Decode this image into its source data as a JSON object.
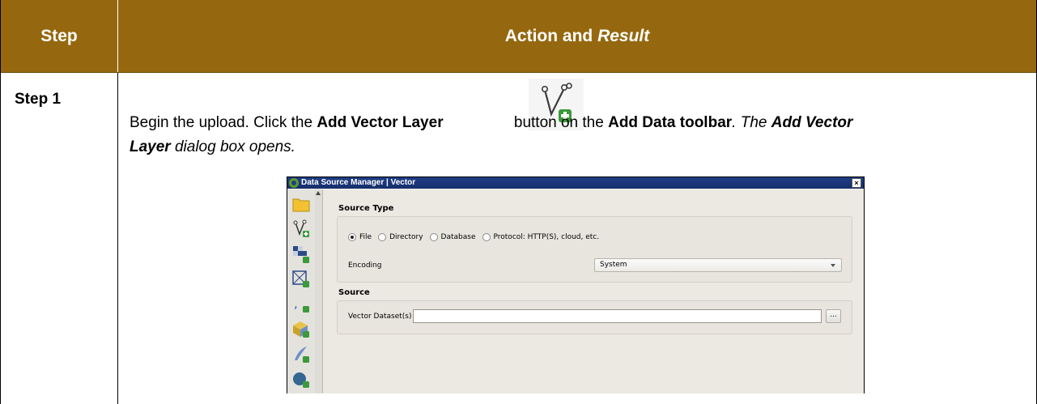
{
  "table": {
    "header_step": "Step",
    "header_action": "Action and",
    "header_result": "Result",
    "row1_step": "Step 1"
  },
  "instruction": {
    "part1": "Begin the upload. Click the ",
    "bold1": "Add Vector Layer",
    "part2": " button on the ",
    "bold2": "Add Data toolbar",
    "part3": ". ",
    "italic1": "The ",
    "bold_italic1": "Add Vector",
    "bold_italic2": "Layer",
    "italic2": " dialog box opens."
  },
  "dialog": {
    "title": "Data Source Manager | Vector",
    "close": "×",
    "source_type_label": "Source Type",
    "radios": [
      {
        "label": "File",
        "selected": true
      },
      {
        "label": "Directory",
        "selected": false
      },
      {
        "label": "Database",
        "selected": false
      },
      {
        "label": "Protocol: HTTP(S), cloud, etc.",
        "selected": false
      }
    ],
    "encoding_label": "Encoding",
    "encoding_value": "System",
    "source_label": "Source",
    "vector_dataset_label": "Vector Dataset(s)",
    "vector_dataset_value": "",
    "browse_label": "...",
    "sidebar_icons": [
      "folder-icon",
      "vector-layer-icon",
      "raster-layer-icon",
      "mesh-layer-icon",
      "delimited-text-icon",
      "geopackage-icon",
      "spatialite-icon",
      "postgis-icon"
    ]
  },
  "colors": {
    "header_bg": "#95680f",
    "header_text": "#ffffff",
    "dialog_title_bg": "#1f3e86"
  }
}
